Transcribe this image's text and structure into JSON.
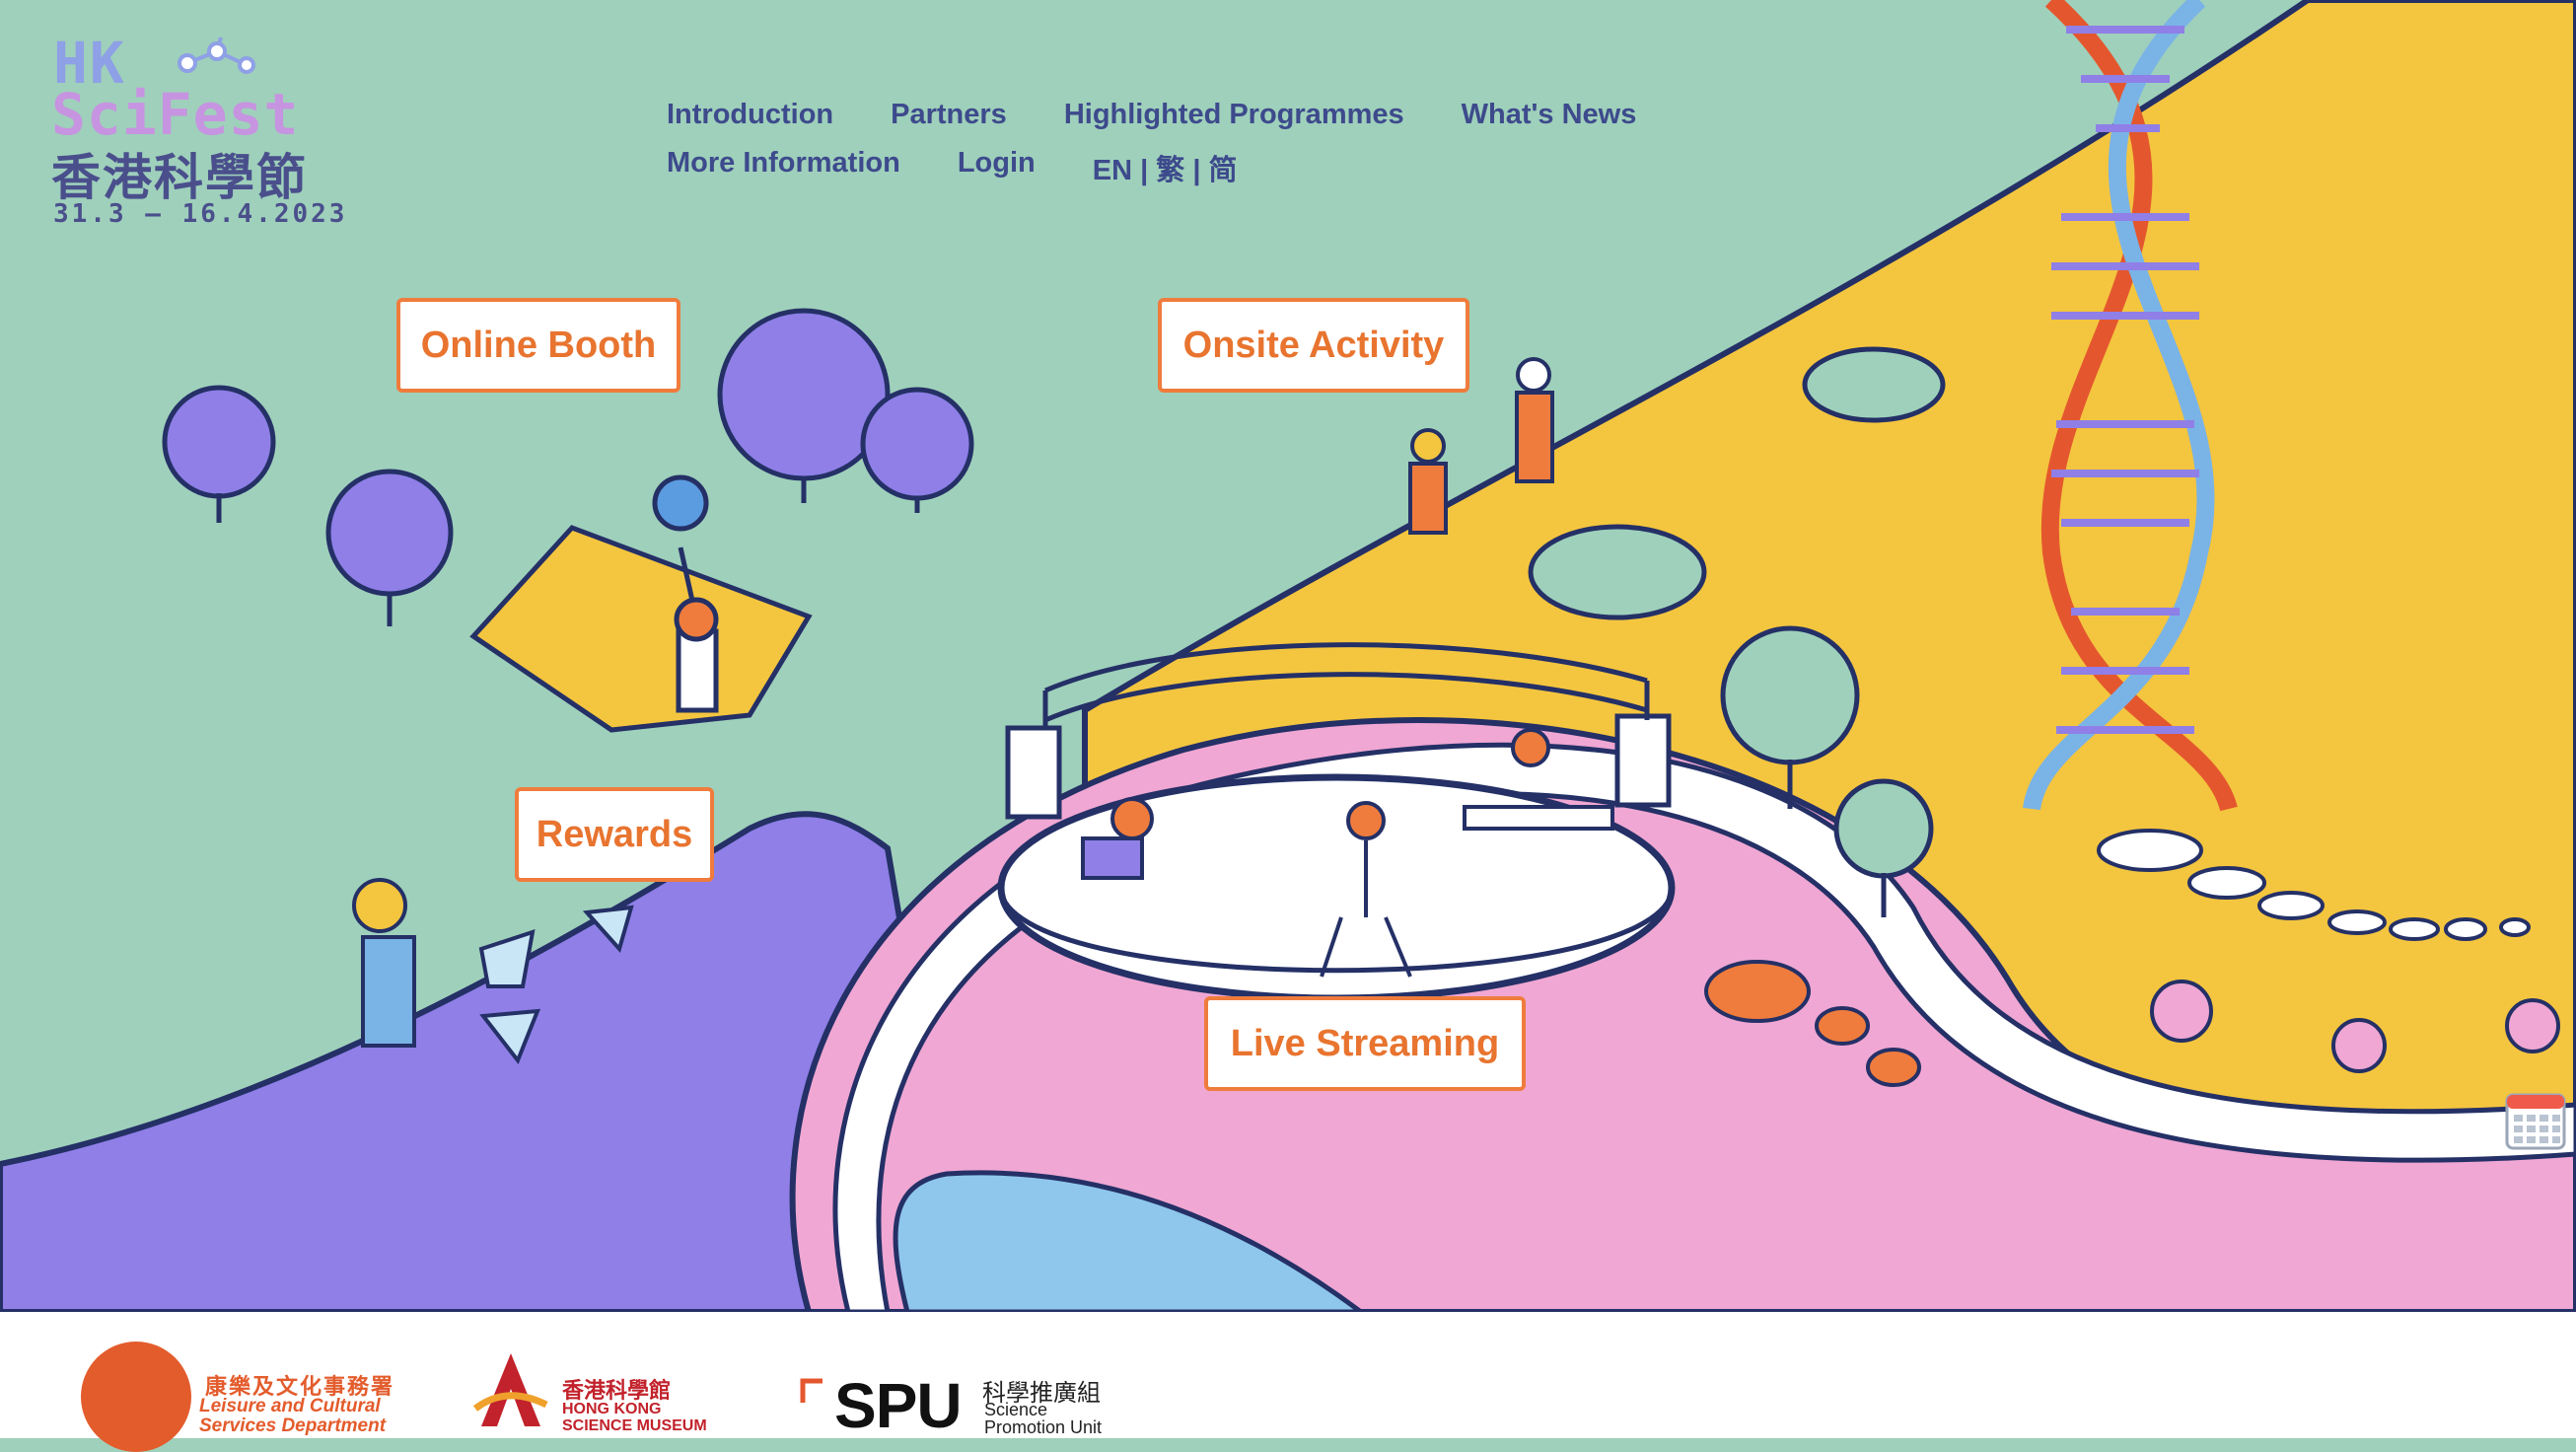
{
  "logo": {
    "line1": "HK",
    "line2": "SciFest",
    "chinese": "香港科學節",
    "dates": "31.3 – 16.4.2023"
  },
  "nav": {
    "row1": [
      "Introduction",
      "Partners",
      "Highlighted Programmes",
      "What's News"
    ],
    "row2": [
      "More Information",
      "Login",
      "EN | 繁 | 简"
    ]
  },
  "zones": {
    "online_booth": "Online Booth",
    "onsite_activity": "Onsite Activity",
    "rewards": "Rewards",
    "live_streaming": "Live Streaming"
  },
  "footer": {
    "lcsd_zh": "康樂及文化事務署",
    "lcsd_en1": "Leisure and Cultural",
    "lcsd_en2": "Services Department",
    "hksm_zh": "香港科學館",
    "hksm_en1": "HONG KONG",
    "hksm_en2": "SCIENCE MUSEUM",
    "spu_mark": "SPU",
    "spu_zh": "科學推廣組",
    "spu_en1": "Science",
    "spu_en2": "Promotion Unit"
  },
  "icons": {
    "calendar": "calendar-icon",
    "molecule": "molecule-icon"
  },
  "colors": {
    "mint": "#9fd0bb",
    "yellow": "#f4c53f",
    "pink": "#f0a7d3",
    "purple": "#8f7fe7",
    "sky": "#8fc7ec",
    "accent_orange": "#ef7c3d",
    "nav_navy": "#3d4a8c"
  }
}
